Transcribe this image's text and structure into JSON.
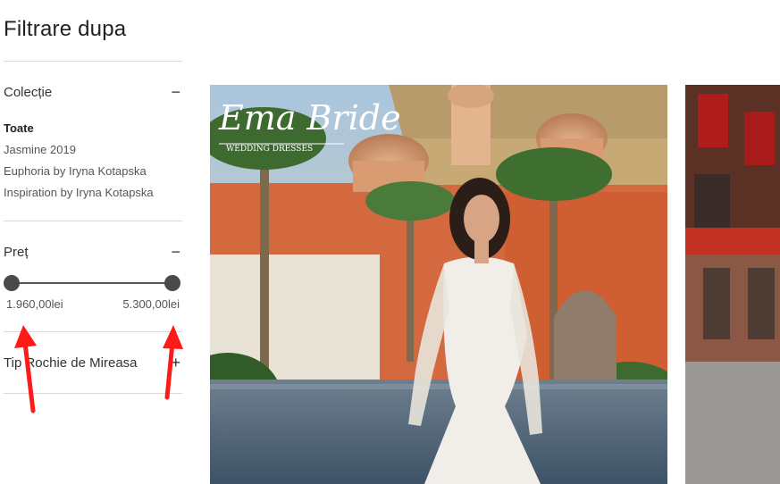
{
  "sidebar": {
    "title": "Filtrare dupa",
    "sections": {
      "collection": {
        "label": "Colecție",
        "toggle": "−",
        "items": [
          {
            "label": "Toate",
            "active": true
          },
          {
            "label": "Jasmine 2019",
            "active": false
          },
          {
            "label": "Euphoria by Iryna Kotapska",
            "active": false
          },
          {
            "label": "Inspiration by Iryna Kotapska",
            "active": false
          }
        ]
      },
      "price": {
        "label": "Preț",
        "toggle": "−",
        "min_value": "1.960,00lei",
        "max_value": "5.300,00lei"
      },
      "dress_type": {
        "label": "Tip Rochie de Mireasa",
        "toggle": "+"
      }
    }
  },
  "products": {
    "item1": {
      "brand_text": "Ema Bride",
      "brand_subtext": "WEDDING DRESSES"
    }
  },
  "colors": {
    "annotation_arrow": "#ff1a1a",
    "slider_handle": "#4a4a4a"
  }
}
